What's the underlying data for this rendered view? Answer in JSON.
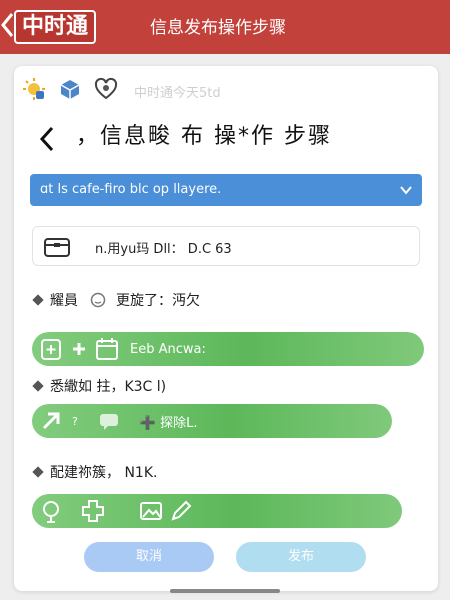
{
  "app": {
    "logo": "中时通",
    "title": "信息发布操作步骤"
  },
  "toolbar": {
    "icons": [
      "sun-face-icon",
      "package-icon",
      "heart-badge-icon"
    ],
    "faded_text": "中时通今天5td"
  },
  "header": {
    "title": "，信息畯  布  操*作  步骤"
  },
  "dropdown": {
    "value": "ɑt ls cafe-firo blc op llayere."
  },
  "info": {
    "text": "n.用yu玛 Dll： D.C   63"
  },
  "sections": [
    {
      "label": "耀員",
      "status_text": "更旋了：沔欠"
    },
    {
      "label": "悉繖如  拄，K3C l)"
    },
    {
      "label": "配建祢簇， N1K."
    }
  ],
  "bars": [
    {
      "text": "Eeb Ancwa:",
      "icons": [
        "clipboard-add-icon",
        "plus-icon",
        "calendar-icon"
      ]
    },
    {
      "text": "➕ 探除L.",
      "icons": [
        "arrow-up-right-icon",
        "chat-bubble-icon"
      ],
      "mark": "?"
    },
    {
      "icons": [
        "location-pin-icon",
        "medical-plus-icon",
        "image-icon",
        "pencil-icon"
      ]
    }
  ],
  "buttons": {
    "left": "取消",
    "right": "发布"
  },
  "colors": {
    "topbar": "#c2413a",
    "dropdown": "#4a8fd8",
    "bar_green": "#5db85a",
    "btn_left": "#6fa7ee",
    "btn_right": "#7cc8e6"
  }
}
